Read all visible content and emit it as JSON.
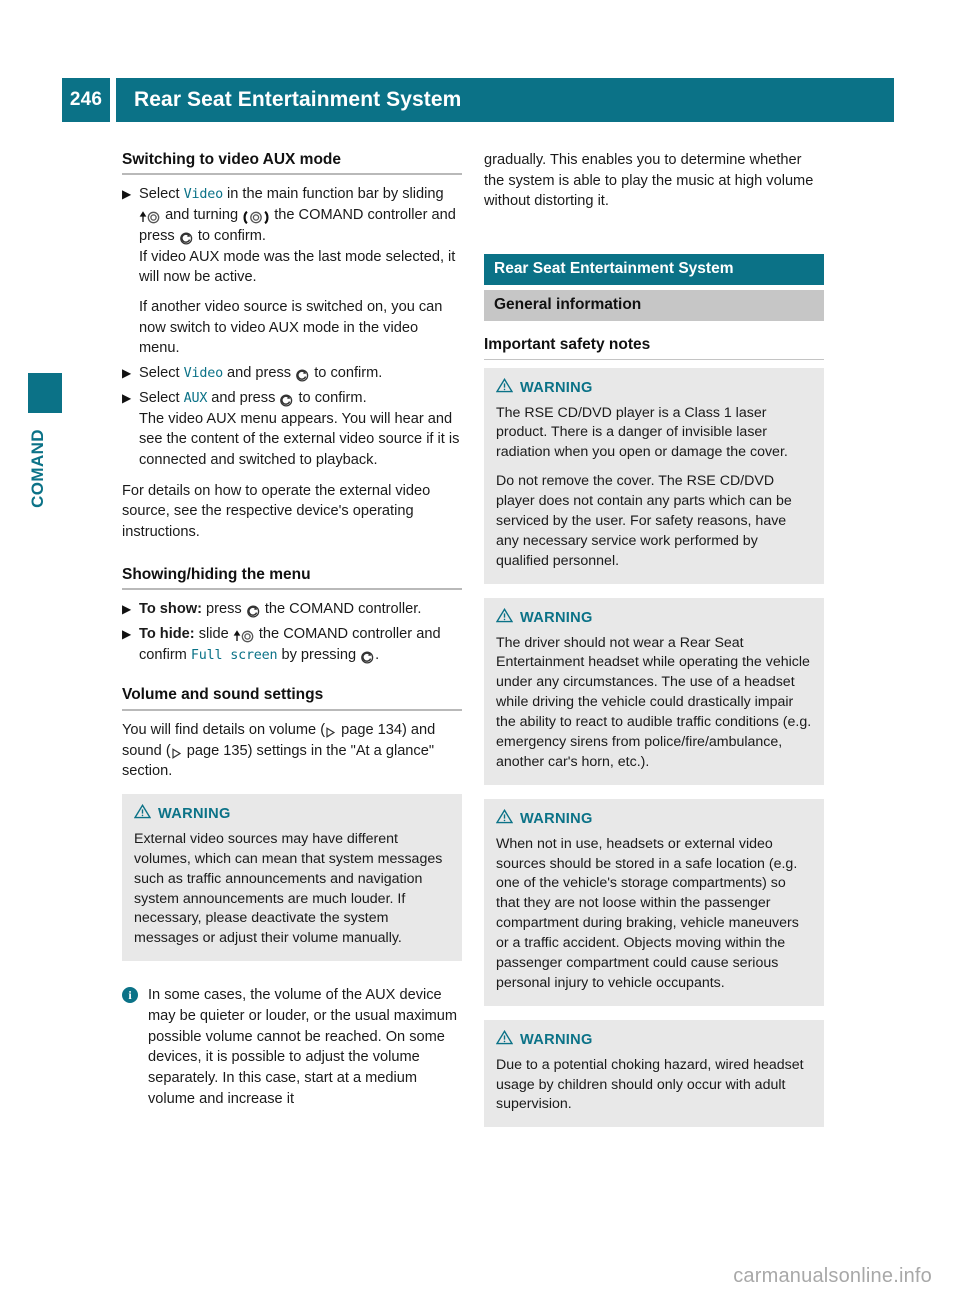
{
  "header": {
    "page_number": "246",
    "title": "Rear Seat Entertainment System"
  },
  "side_tab": {
    "label": "COMAND"
  },
  "left_column": {
    "heading_1": "Switching to video AUX mode",
    "step_1": {
      "lead": "Select",
      "ui_1": "Video",
      "text_1": "in the main function bar by sliding",
      "text_2": "and turning",
      "text_3": "the COMAND controller and press",
      "text_4": "to confirm.",
      "cont_1": "If video AUX mode was the last mode selected, it will now be active.",
      "cont_2": "If another video source is switched on, you can now switch to video AUX mode in the video menu."
    },
    "step_2": {
      "lead": "Select",
      "ui": "Video",
      "text_1": "and press",
      "text_2": "to confirm."
    },
    "step_3": {
      "lead": "Select",
      "ui": "AUX",
      "text_1": "and press",
      "text_2": "to confirm.",
      "cont_1": "The video AUX menu appears. You will hear and see the content of the external video source if it is connected and switched to playback."
    },
    "para_1": "For details on how to operate the external video source, see the respective device's operating instructions.",
    "heading_2": "Showing/hiding the menu",
    "step_4": {
      "lead": "To show:",
      "text_1": "press",
      "text_2": "the COMAND controller."
    },
    "step_5": {
      "lead": "To hide:",
      "text_1": "slide",
      "text_2": "the COMAND controller and confirm",
      "ui": "Full screen",
      "text_3": "by pressing",
      "text_4": "."
    },
    "heading_3": "Volume and sound settings",
    "para_2_a": "You will find details on volume (",
    "para_2_b": "page 134) and sound (",
    "para_2_c": "page 135) settings in the \"At a glance\" section.",
    "warning_1": {
      "label": "WARNING",
      "body": "External video sources may have different volumes, which can mean that system messages such as traffic announcements and navigation system announcements are much louder. If necessary, please deactivate the system messages or adjust their volume manually."
    },
    "note_1": {
      "icon": "info-icon",
      "body": "In some cases, the volume of the AUX device may be quieter or louder, or the usual maximum possible volume cannot be reached. On some devices, it is possible to adjust the volume separately. In this case, start at a medium volume and increase it"
    }
  },
  "right_column": {
    "para_cont": "gradually. This enables you to determine whether the system is able to play the music at high volume without distorting it.",
    "banner_teal": "Rear Seat Entertainment System",
    "banner_grey": "General information",
    "heading_1": "Important safety notes",
    "warning_2": {
      "label": "WARNING",
      "body_1": "The RSE CD/DVD player is a Class 1 laser product. There is a danger of invisible laser radiation when you open or damage the cover.",
      "body_2": "Do not remove the cover. The RSE CD/DVD player does not contain any parts which can be serviced by the user. For safety reasons, have any necessary service work performed by qualified personnel."
    },
    "warning_3": {
      "label": "WARNING",
      "body": "The driver should not wear a Rear Seat Entertainment headset while operating the vehicle under any circumstances. The use of a headset while driving the vehicle could drastically impair the ability to react to audible traffic conditions (e.g. emergency sirens from police/fire/ambulance, another car's horn, etc.)."
    },
    "warning_4": {
      "label": "WARNING",
      "body": "When not in use, headsets or external video sources should be stored in a safe location (e.g. one of the vehicle's storage compartments) so that they are not loose within the passenger compartment during braking, vehicle maneuvers or a traffic accident. Objects moving within the passenger compartment could cause serious personal injury to vehicle occupants."
    },
    "warning_5": {
      "label": "WARNING",
      "body": "Due to a potential choking hazard, wired headset usage by children should only occur with adult supervision."
    }
  },
  "watermark": "carmanualsonline.info",
  "colors": {
    "accent_teal": "#0b7287",
    "banner_grey": "#c6c6c6",
    "warning_bg": "#e8e8e8",
    "rule_grey": "#b9b9b9"
  }
}
